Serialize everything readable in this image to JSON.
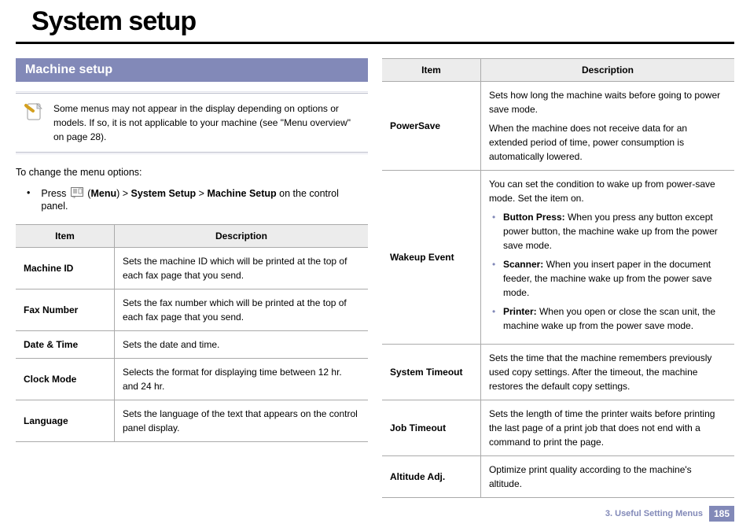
{
  "page_title": "System setup",
  "section_title": "Machine setup",
  "note_text": "Some menus may not appear in the display depending on options or models. If so, it is not applicable to your machine (see \"Menu overview\" on page 28).",
  "intro_text": "To change the menu options:",
  "instruction_prefix": "Press",
  "instruction_menu": "Menu",
  "instruction_path1": "System Setup",
  "instruction_path2": "Machine Setup",
  "instruction_suffix": "on the control panel.",
  "header_item": "Item",
  "header_description": "Description",
  "table1": [
    {
      "item": "Machine ID",
      "desc": "Sets the machine ID which will be printed at the top of each fax page that you send."
    },
    {
      "item": "Fax Number",
      "desc": "Sets the fax number which will be printed at the top of each fax page that you send."
    },
    {
      "item": "Date & Time",
      "desc": "Sets the date and time."
    },
    {
      "item": "Clock Mode",
      "desc": "Selects the format for displaying time between 12 hr. and 24 hr."
    },
    {
      "item": "Language",
      "desc": "Sets the language of the text that appears on the control panel display."
    }
  ],
  "table2": {
    "powersave": {
      "item": "PowerSave",
      "p1": "Sets how long the machine waits before going to power save mode.",
      "p2": "When the machine does not receive data for an extended period of time, power consumption is automatically lowered."
    },
    "wakeup": {
      "item": "Wakeup Event",
      "intro": "You can set the condition to wake up from power-save mode. Set the item on.",
      "b1_label": "Button Press:",
      "b1_text": " When you press any button except power button, the machine wake up from the power save mode.",
      "b2_label": "Scanner:",
      "b2_text": " When you insert paper in the document feeder, the machine wake up from the power save mode.",
      "b3_label": "Printer:",
      "b3_text": " When you open or close the scan unit, the machine wake up from the power save mode."
    },
    "systimeout": {
      "item": "System Timeout",
      "desc": "Sets the time that the machine remembers previously used copy settings. After the timeout, the machine restores the default copy settings."
    },
    "jobtimeout": {
      "item": "Job Timeout",
      "desc": "Sets the length of time the printer waits before printing the last page of a print job that does not end with a command to print the page."
    },
    "altitude": {
      "item": "Altitude Adj.",
      "desc": "Optimize print quality according to the machine's altitude."
    }
  },
  "footer_chapter": "3.  Useful Setting Menus",
  "footer_page": "185"
}
